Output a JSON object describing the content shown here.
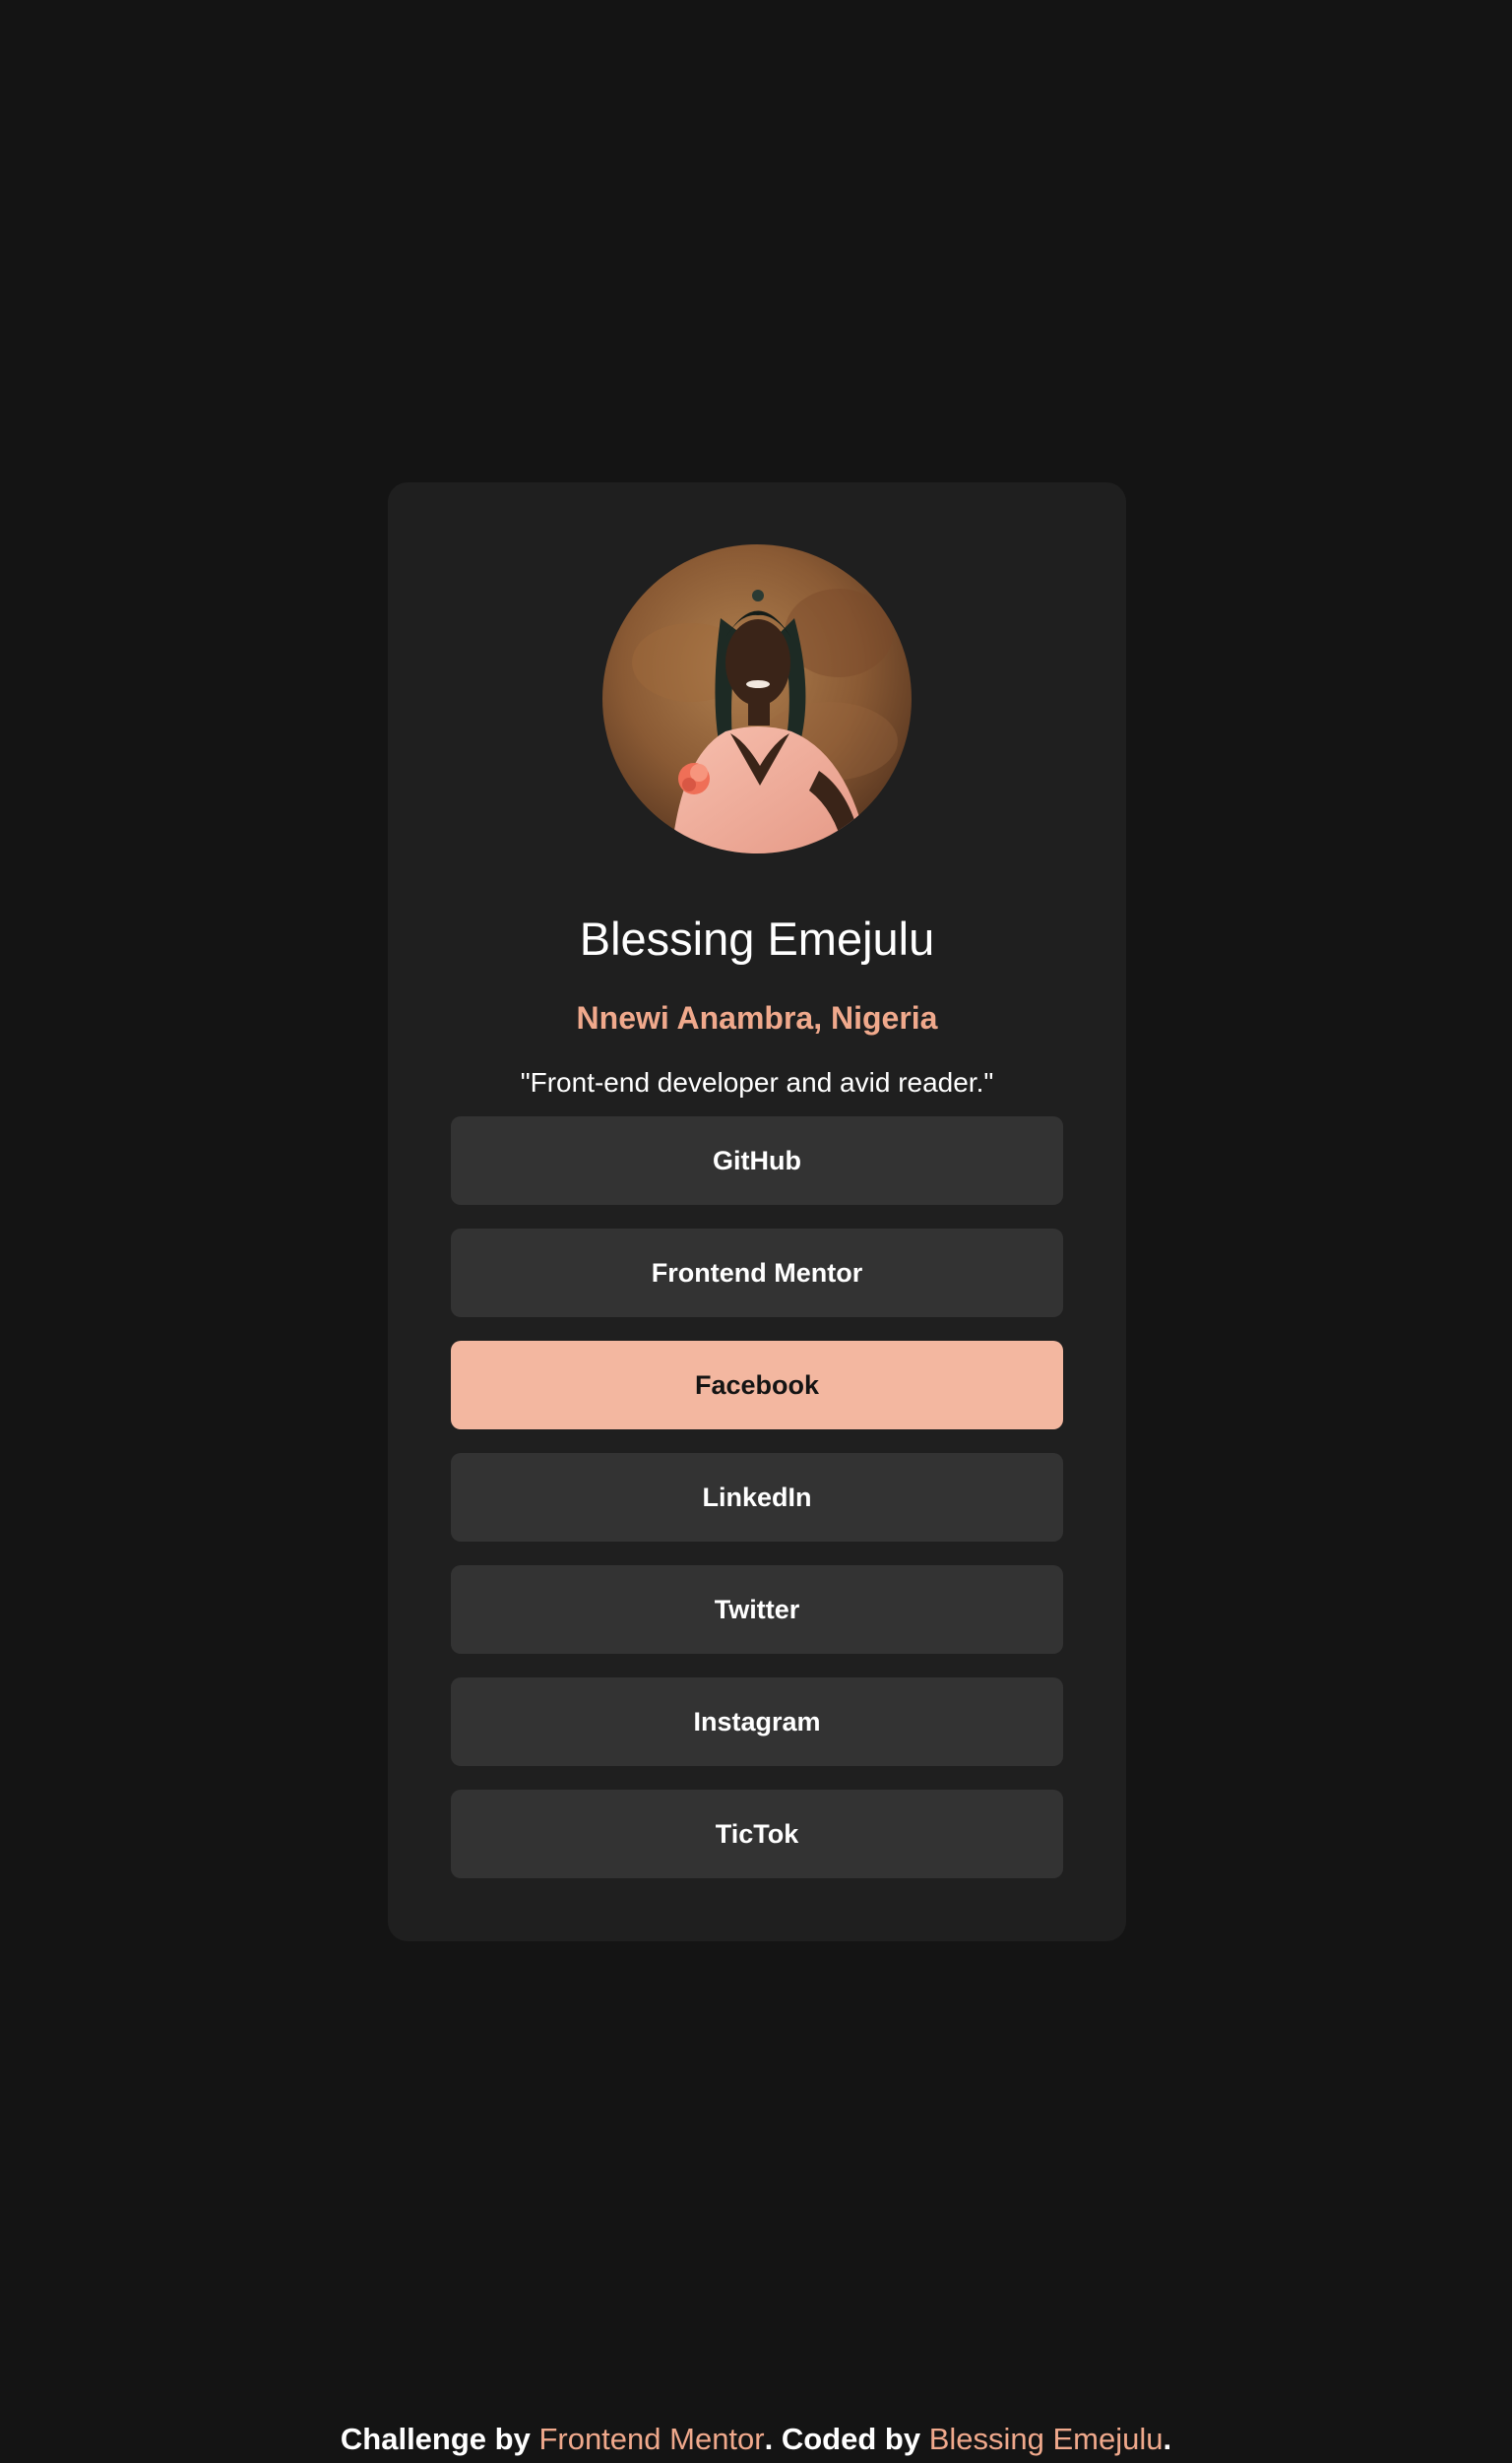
{
  "profile": {
    "name": "Blessing Emejulu",
    "location": "Nnewi Anambra, Nigeria",
    "bio": "\"Front-end developer and avid reader.\"",
    "avatar_icon": "profile-photo"
  },
  "links": [
    {
      "label": "GitHub",
      "active": false
    },
    {
      "label": "Frontend Mentor",
      "active": false
    },
    {
      "label": "Facebook",
      "active": true
    },
    {
      "label": "LinkedIn",
      "active": false
    },
    {
      "label": "Twitter",
      "active": false
    },
    {
      "label": "Instagram",
      "active": false
    },
    {
      "label": "TicTok",
      "active": false
    }
  ],
  "footer": {
    "prefix": "Challenge by ",
    "challenge_link": "Frontend Mentor",
    "middle": ". Coded by ",
    "author_link": "Blessing Emejulu",
    "suffix": "."
  },
  "colors": {
    "background": "#141414",
    "card": "#1f1f1f",
    "button": "#333333",
    "accent": "#f0a98c",
    "active_button": "#f3b7a0"
  }
}
